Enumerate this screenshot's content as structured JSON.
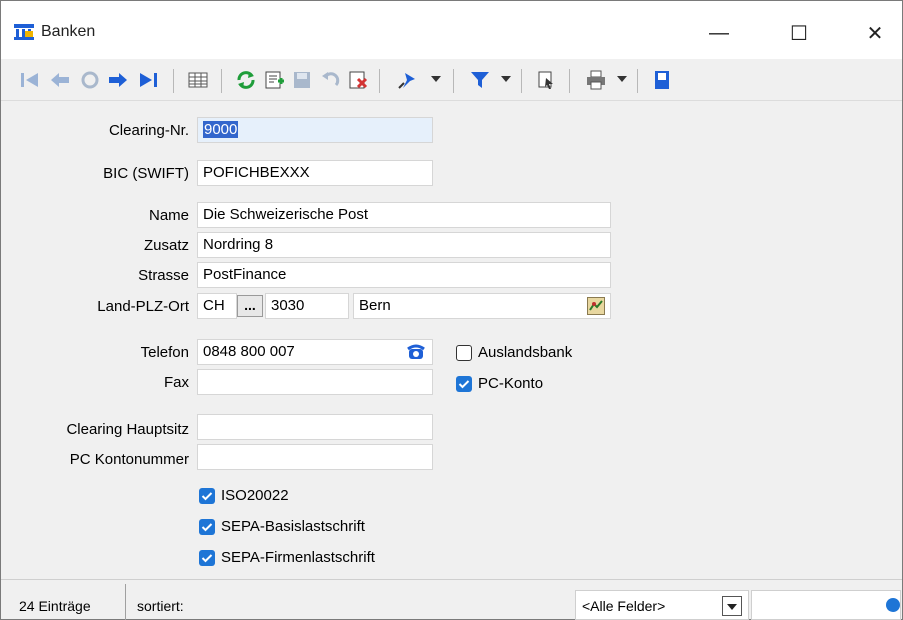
{
  "window": {
    "title": "Banken",
    "minimize": "—",
    "maximize": "☐",
    "close": "✕"
  },
  "form": {
    "clearing_nr": {
      "label": "Clearing-Nr.",
      "value": "9000"
    },
    "bic": {
      "label": "BIC (SWIFT)",
      "value": "POFICHBEXXX"
    },
    "name": {
      "label": "Name",
      "value": "Die Schweizerische Post"
    },
    "zusatz": {
      "label": "Zusatz",
      "value": "Nordring 8"
    },
    "strasse": {
      "label": "Strasse",
      "value": "PostFinance"
    },
    "land_plz_ort": {
      "label": "Land-PLZ-Ort",
      "land": "CH",
      "picker": "...",
      "plz": "3030",
      "ort": "Bern"
    },
    "telefon": {
      "label": "Telefon",
      "value": "0848 800 007"
    },
    "fax": {
      "label": "Fax",
      "value": ""
    },
    "clearing_hauptsitz": {
      "label": "Clearing Hauptsitz",
      "value": ""
    },
    "pc_kontonummer": {
      "label": "PC Kontonummer",
      "value": ""
    },
    "auslandsbank": {
      "label": "Auslandsbank",
      "checked": false
    },
    "pc_konto": {
      "label": "PC-Konto",
      "checked": true
    },
    "iso20022": {
      "label": "ISO20022",
      "checked": true
    },
    "sepa_basis": {
      "label": "SEPA-Basislastschrift",
      "checked": true
    },
    "sepa_firmen": {
      "label": "SEPA-Firmenlastschrift",
      "checked": true
    }
  },
  "statusbar": {
    "count": "24 Einträge",
    "sort": "sortiert:",
    "field_select": "<Alle Felder>"
  },
  "colors": {
    "accent": "#1e75d6",
    "selection": "#3366cc",
    "nav_arrow": "#1e5fd6",
    "refresh": "#1f9d3a",
    "delete": "#d23333"
  }
}
